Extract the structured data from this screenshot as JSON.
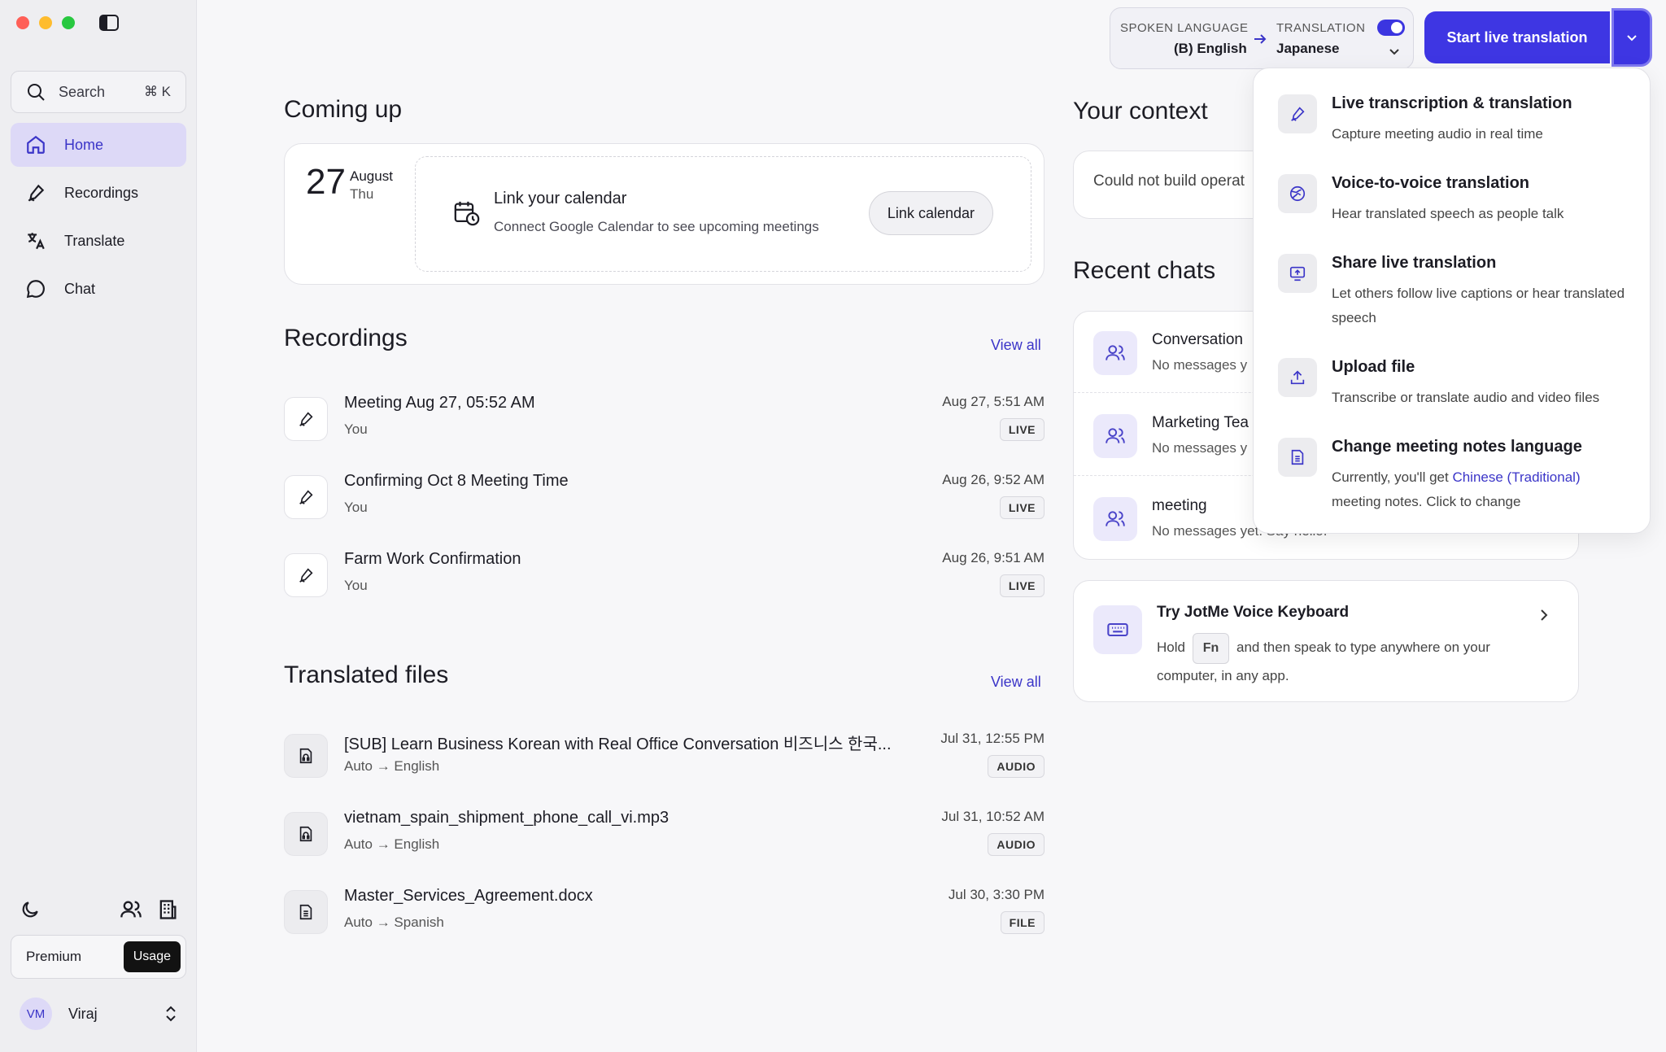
{
  "sidebar": {
    "search": {
      "label": "Search",
      "shortcut": "⌘ K"
    },
    "nav": [
      {
        "label": "Home",
        "icon": "home-icon",
        "active": true
      },
      {
        "label": "Recordings",
        "icon": "pen-icon"
      },
      {
        "label": "Translate",
        "icon": "translate-icon"
      },
      {
        "label": "Chat",
        "icon": "chat-icon"
      }
    ],
    "plan": {
      "name": "Premium",
      "usage_label": "Usage"
    },
    "user": {
      "initials": "VM",
      "name": "Viraj"
    }
  },
  "header": {
    "spoken_label": "SPOKEN LANGUAGE",
    "spoken_value": "(B) English",
    "translation_label": "TRANSLATION",
    "translation_value": "Japanese",
    "translation_enabled": true,
    "start_button": "Start live translation"
  },
  "coming_up": {
    "title": "Coming up",
    "date_num": "27",
    "date_month": "August",
    "date_day": "Thu",
    "calendar_title": "Link your calendar",
    "calendar_desc": "Connect Google Calendar to see upcoming meetings",
    "calendar_button": "Link calendar"
  },
  "recordings": {
    "title": "Recordings",
    "view_all": "View all",
    "items": [
      {
        "title": "Meeting Aug 27, 05:52 AM",
        "sub": "You",
        "time": "Aug 27, 5:51 AM",
        "badge": "LIVE"
      },
      {
        "title": "Confirming Oct 8 Meeting Time",
        "sub": "You",
        "time": "Aug 26, 9:52 AM",
        "badge": "LIVE"
      },
      {
        "title": "Farm Work Confirmation",
        "sub": "You",
        "time": "Aug 26, 9:51 AM",
        "badge": "LIVE"
      }
    ]
  },
  "translated_files": {
    "title": "Translated files",
    "view_all": "View all",
    "items": [
      {
        "title": "[SUB] Learn Business Korean with Real Office Conversation 비즈니스 한국...",
        "sub": "Auto → English",
        "time": "Jul 31, 12:55 PM",
        "badge": "AUDIO"
      },
      {
        "title": "vietnam_spain_shipment_phone_call_vi.mp3",
        "sub": "Auto → English",
        "time": "Jul 31, 10:52 AM",
        "badge": "AUDIO"
      },
      {
        "title": "Master_Services_Agreement.docx",
        "sub": "Auto → Spanish",
        "time": "Jul 30, 3:30 PM",
        "badge": "FILE"
      }
    ]
  },
  "context": {
    "title": "Your context",
    "message": "Could not build operat"
  },
  "recent_chats": {
    "title": "Recent chats",
    "items": [
      {
        "title": "Conversation",
        "sub": "No messages y"
      },
      {
        "title": "Marketing Tea",
        "sub": "No messages y"
      },
      {
        "title": "meeting",
        "sub": "No messages yet. Say hello."
      }
    ]
  },
  "keyboard_card": {
    "title": "Try JotMe Voice Keyboard",
    "desc_pre": "Hold",
    "key": "Fn",
    "desc_post": "and then speak to type anywhere on your computer, in any app."
  },
  "dropdown": {
    "items": [
      {
        "title": "Live transcription & translation",
        "desc": "Capture meeting audio in real time",
        "icon": "pen-icon"
      },
      {
        "title": "Voice-to-voice translation",
        "desc": "Hear translated speech as people talk",
        "icon": "globe-icon"
      },
      {
        "title": "Share live translation",
        "desc": "Let others follow live captions or hear translated speech",
        "icon": "screen-share-icon"
      },
      {
        "title": "Upload file",
        "desc": "Transcribe or translate audio and video files",
        "icon": "upload-icon"
      },
      {
        "title": "Change meeting notes language",
        "desc_pre": "Currently, you'll get",
        "desc_link": "Chinese (Traditional)",
        "desc_post": "meeting notes. Click to change",
        "icon": "document-icon"
      }
    ]
  },
  "colors": {
    "accent": "#3e36e3",
    "active_bg": "#ddd9f7"
  }
}
